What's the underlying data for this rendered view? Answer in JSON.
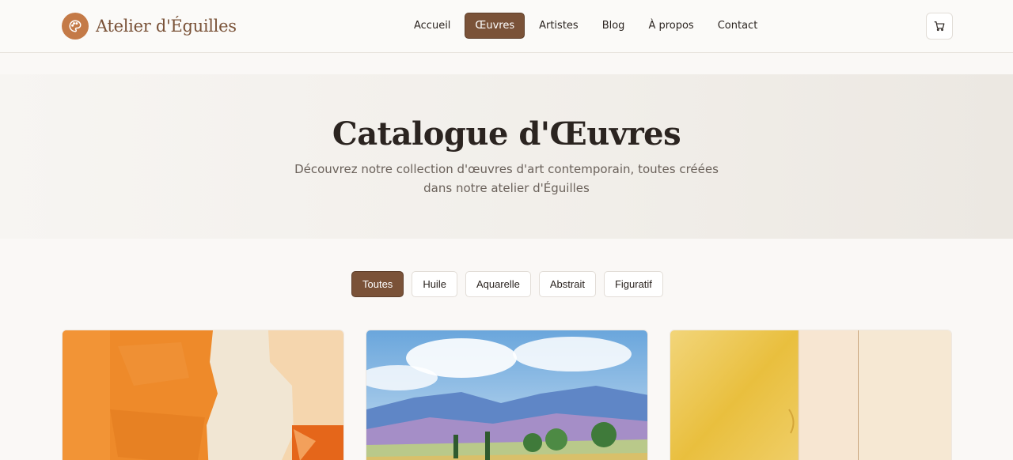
{
  "header": {
    "brand": "Atelier d'Éguilles",
    "nav": [
      {
        "label": "Accueil",
        "active": false
      },
      {
        "label": "Œuvres",
        "active": true
      },
      {
        "label": "Artistes",
        "active": false
      },
      {
        "label": "Blog",
        "active": false
      },
      {
        "label": "À propos",
        "active": false
      },
      {
        "label": "Contact",
        "active": false
      }
    ],
    "cart_icon": "shopping-cart-icon",
    "logo_icon": "palette-icon"
  },
  "hero": {
    "title": "Catalogue d'Œuvres",
    "subtitle": "Découvrez notre collection d'œuvres d'art contemporain, toutes créées dans notre atelier d'Éguilles"
  },
  "filters": [
    {
      "label": "Toutes",
      "active": true
    },
    {
      "label": "Huile",
      "active": false
    },
    {
      "label": "Aquarelle",
      "active": false
    },
    {
      "label": "Abstrait",
      "active": false
    },
    {
      "label": "Figuratif",
      "active": false
    }
  ],
  "colors": {
    "accent": "#7a5238",
    "logo": "#c47a47",
    "background": "#faf8f6"
  }
}
